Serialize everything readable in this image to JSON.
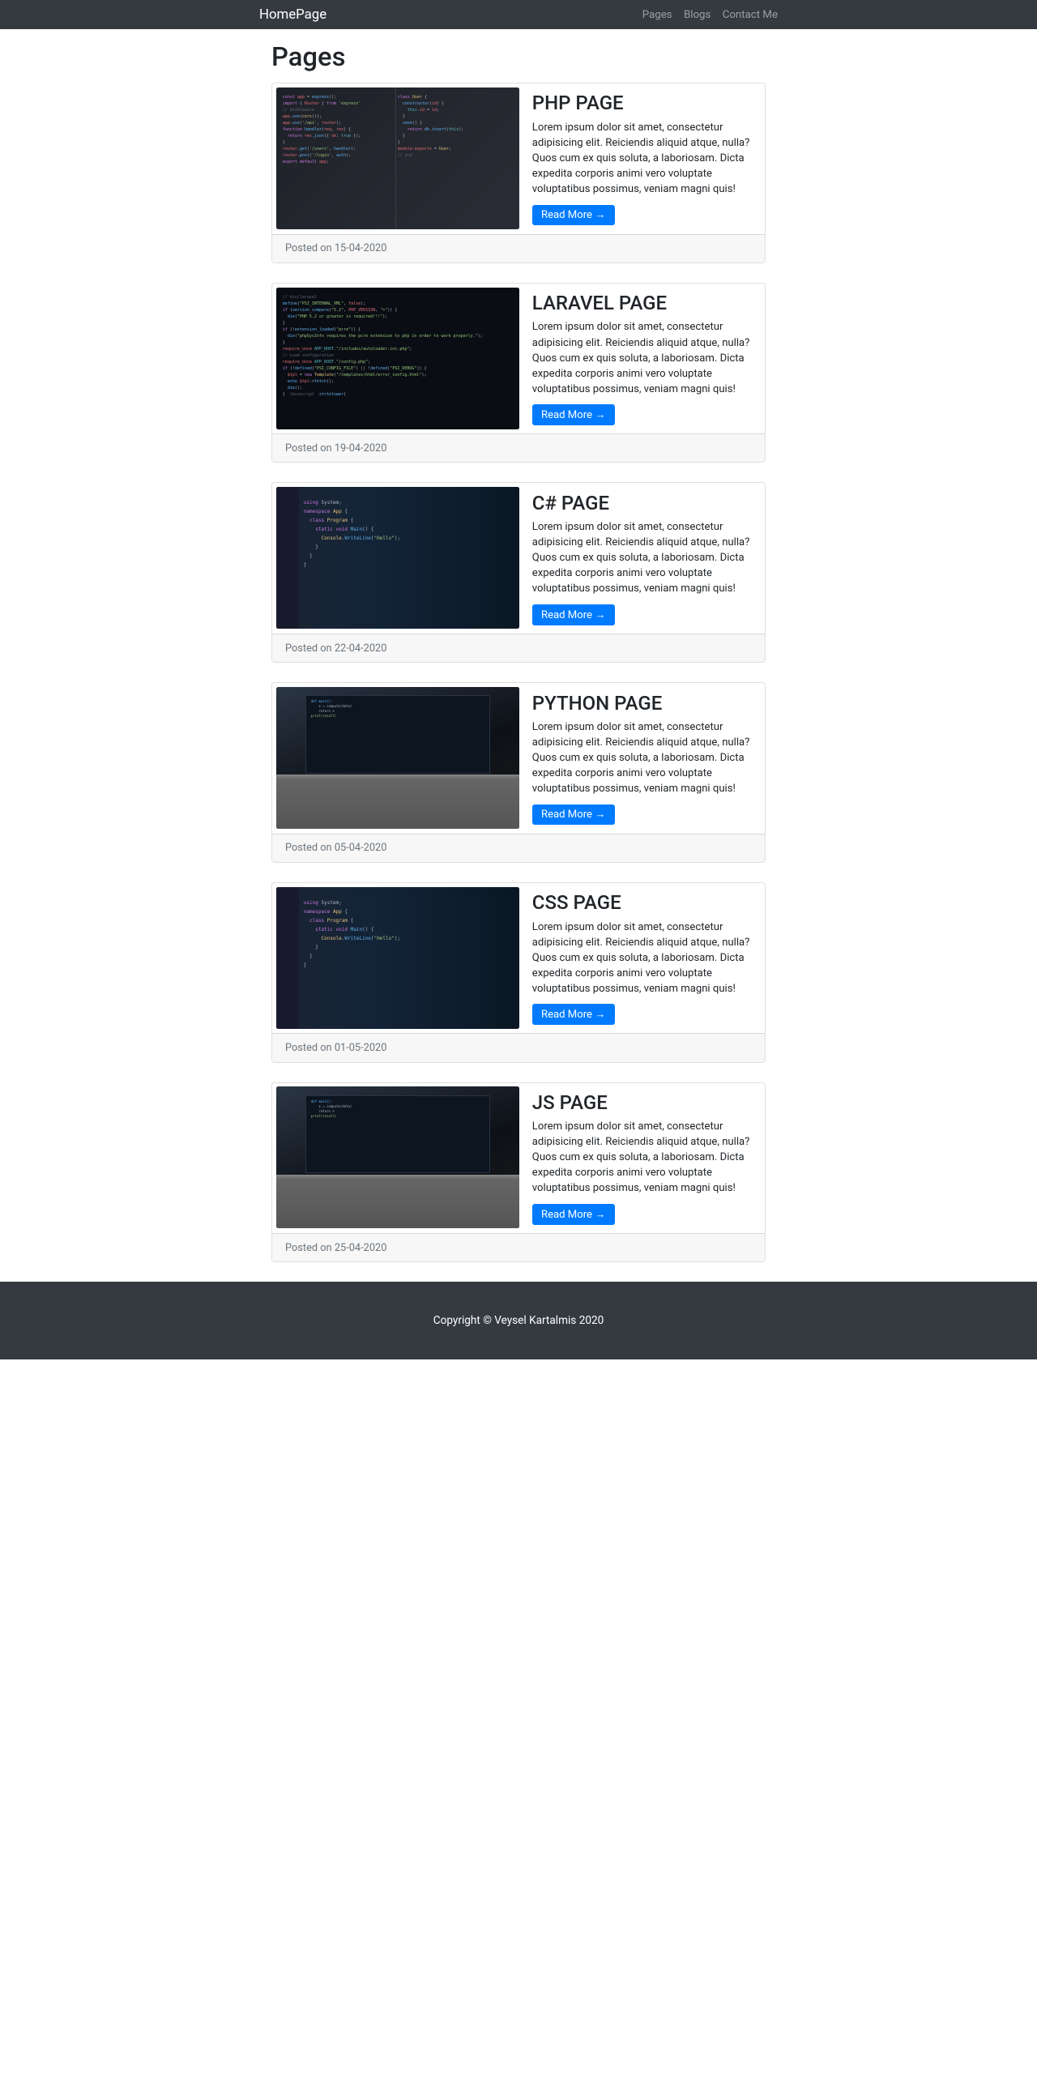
{
  "nav": {
    "brand": "HomePage",
    "links": [
      {
        "label": "Pages"
      },
      {
        "label": "Blogs"
      },
      {
        "label": "Contact Me"
      }
    ]
  },
  "heading": "Pages",
  "excerpt": "Lorem ipsum dolor sit amet, consectetur adipisicing elit. Reiciendis aliquid atque, nulla? Quos cum ex quis soluta, a laboriosam. Dicta expedita corporis animi vero voluptate voluptatibus possimus, veniam magni quis!",
  "read_more": "Read More →",
  "posted_prefix": "Posted on ",
  "pages": [
    {
      "title": "PHP PAGE",
      "date": "15-04-2020",
      "thumb": "dark-code"
    },
    {
      "title": "LARAVEL PAGE",
      "date": "19-04-2020",
      "thumb": "black-code"
    },
    {
      "title": "C# PAGE",
      "date": "22-04-2020",
      "thumb": "editor"
    },
    {
      "title": "PYTHON PAGE",
      "date": "05-04-2020",
      "thumb": "laptop"
    },
    {
      "title": "CSS PAGE",
      "date": "01-05-2020",
      "thumb": "editor"
    },
    {
      "title": "JS PAGE",
      "date": "25-04-2020",
      "thumb": "laptop"
    }
  ],
  "footer": "Copyright © Veysel Kartalmis 2020"
}
